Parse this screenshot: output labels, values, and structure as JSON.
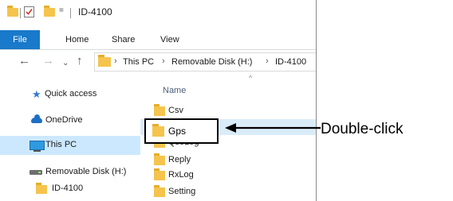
{
  "window": {
    "title": "ID-4100",
    "quick_access_dropdown": "="
  },
  "ribbon": {
    "tabs": [
      {
        "label": "File"
      },
      {
        "label": "Home"
      },
      {
        "label": "Share"
      },
      {
        "label": "View"
      }
    ]
  },
  "address_bar": {
    "breadcrumbs": [
      "This PC",
      "Removable Disk (H:)",
      "ID-4100"
    ],
    "separator": "›"
  },
  "navigation_pane": {
    "items": [
      {
        "label": "Quick access",
        "icon": "star-icon"
      },
      {
        "label": "OneDrive",
        "icon": "cloud-icon"
      },
      {
        "label": "This PC",
        "icon": "computer-icon",
        "selected": true
      },
      {
        "label": "Removable Disk (H:)",
        "icon": "drive-icon"
      },
      {
        "label": "ID-4100",
        "icon": "folder-icon"
      }
    ]
  },
  "file_list": {
    "column_header": "Name",
    "items": [
      {
        "name": "Csv"
      },
      {
        "name": "Gps",
        "selected": true
      },
      {
        "name": "QsoLog"
      },
      {
        "name": "Reply"
      },
      {
        "name": "RxLog"
      },
      {
        "name": "Setting"
      }
    ]
  },
  "annotation": {
    "text": "Double-click"
  },
  "colors": {
    "file_tab": "#1979ca",
    "folder": "#f5c44d",
    "selection": "#cce8ff"
  }
}
